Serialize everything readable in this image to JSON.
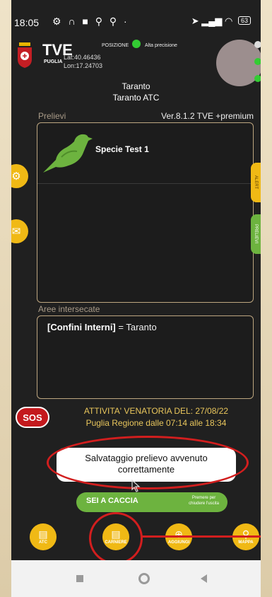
{
  "status_bar": {
    "time": "18:05",
    "battery": "63"
  },
  "header": {
    "app_name": "TVE",
    "region": "PUGLIA",
    "lat": "Lat:40.46436",
    "lon": "Lon:17.24703",
    "position_label": "POSIZIONE",
    "precision_label": "Alta precisione",
    "city": "Taranto",
    "atc": "Taranto ATC"
  },
  "prelievi": {
    "label": "Prelievi",
    "version": "Ver.8.1.2 TVE +premium",
    "items": [
      {
        "species": "Specie Test 1"
      }
    ]
  },
  "aree": {
    "label": "Aree intersecate",
    "bold": "[Confini Interni]",
    "value": "= Taranto"
  },
  "side_tabs": {
    "alert": "ALERT",
    "prelievi": "PRELIEVI"
  },
  "sos_label": "SOS",
  "activity": {
    "line1": "ATTIVITA' VENATORIA DEL: 27/08/22",
    "line2": "Puglia Regione dalle 07:14 alle 18:34"
  },
  "toast": {
    "line1": "Salvataggio prelievo avvenuto",
    "line2": "correttamente"
  },
  "caccia": {
    "label": "SEI A CACCIA",
    "hint_line1": "Premere per",
    "hint_line2": "chiudere l'uscita"
  },
  "bottom_nav": [
    {
      "label": "ATC",
      "icon": "atc-icon"
    },
    {
      "label": "CARNIERE",
      "icon": "carniere-icon"
    },
    {
      "label": "AGGIUNGI",
      "icon": "add-pin-icon"
    },
    {
      "label": "MAPPA",
      "icon": "map-pin-icon"
    }
  ],
  "colors": {
    "accent": "#f0b915",
    "green": "#6db33f",
    "annotation_red": "#d21e1e",
    "sos_red": "#c4191d"
  }
}
